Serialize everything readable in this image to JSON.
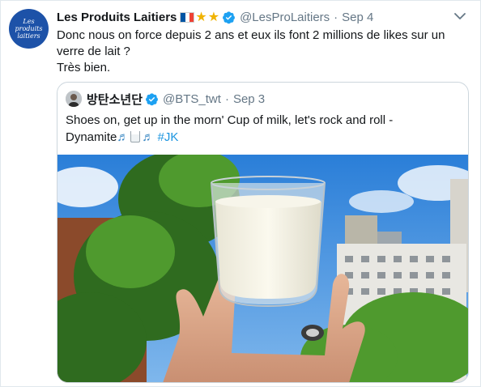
{
  "tweet": {
    "avatar_lines": [
      "Les produits",
      "laitiers"
    ],
    "display_name": "Les Produits Laitiers",
    "handle": "@LesProLaitiers",
    "separator": "·",
    "time": "Sep 4",
    "text_lines": [
      "Donc nous on force depuis 2 ans et eux ils font 2 millions de likes sur un",
      "verre de lait ?",
      "Très bien."
    ],
    "icons": [
      "france-flag-icon",
      "star-icon",
      "star-icon",
      "verified-badge-icon",
      "chevron-down-icon"
    ]
  },
  "quoted_tweet": {
    "display_name": "방탄소년단",
    "handle": "@BTS_twt",
    "separator": "·",
    "time": "Sep 3",
    "text_line1": "Shoes on, get up in the morn' Cup of milk, let's rock and roll -",
    "text_line2_prefix": "Dynamite",
    "note_glyph": "♬",
    "hashtag": "#JK",
    "media_icon": "milk-glass-photo"
  },
  "colors": {
    "text": "#14171a",
    "secondary": "#657786",
    "verified": "#1da1f2",
    "border": "#ccd6dd",
    "avatar_bg": "#1d52a8",
    "star": "#f0b300"
  }
}
